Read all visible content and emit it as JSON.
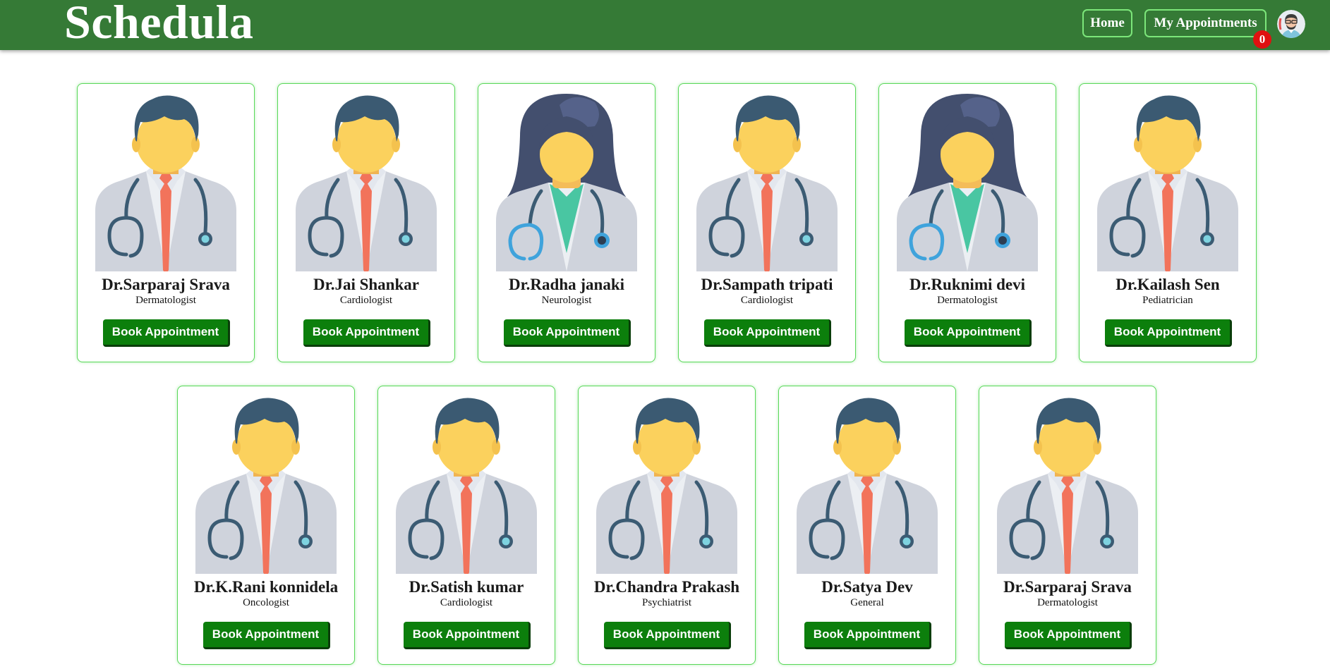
{
  "navbar": {
    "brand": "Schedula",
    "home_label": "Home",
    "appointments_label": "My Appointments",
    "appointments_count": "0",
    "avatar_icon": "user-avatar-icon"
  },
  "colors": {
    "navbar_bg": "#357a36",
    "nav_button_border": "#7ce67a",
    "badge_bg": "#e01010",
    "card_border": "#59d859",
    "book_button_bg": "#0c7f0c"
  },
  "doctors": [
    {
      "name": "Dr.Sarparaj Srava",
      "specialty": "Dermatologist",
      "avatar": "male-doctor-icon",
      "button": "Book Appointment"
    },
    {
      "name": "Dr.Jai Shankar",
      "specialty": "Cardiologist",
      "avatar": "male-doctor-icon",
      "button": "Book Appointment"
    },
    {
      "name": "Dr.Radha janaki",
      "specialty": "Neurologist",
      "avatar": "female-doctor-icon",
      "button": "Book Appointment"
    },
    {
      "name": "Dr.Sampath tripati",
      "specialty": "Cardiologist",
      "avatar": "male-doctor-icon",
      "button": "Book Appointment"
    },
    {
      "name": "Dr.Ruknimi devi",
      "specialty": "Dermatologist",
      "avatar": "female-doctor-icon",
      "button": "Book Appointment"
    },
    {
      "name": "Dr.Kailash Sen",
      "specialty": "Pediatrician",
      "avatar": "male-doctor-icon",
      "button": "Book Appointment"
    },
    {
      "name": "Dr.K.Rani konnidela",
      "specialty": "Oncologist",
      "avatar": "male-doctor-icon",
      "button": "Book Appointment"
    },
    {
      "name": "Dr.Satish kumar",
      "specialty": "Cardiologist",
      "avatar": "male-doctor-icon",
      "button": "Book Appointment"
    },
    {
      "name": "Dr.Chandra Prakash",
      "specialty": "Psychiatrist",
      "avatar": "male-doctor-icon",
      "button": "Book Appointment"
    },
    {
      "name": "Dr.Satya Dev",
      "specialty": "General",
      "avatar": "male-doctor-icon",
      "button": "Book Appointment"
    },
    {
      "name": "Dr.Sarparaj Srava",
      "specialty": "Dermatologist",
      "avatar": "male-doctor-icon",
      "button": "Book Appointment"
    }
  ]
}
